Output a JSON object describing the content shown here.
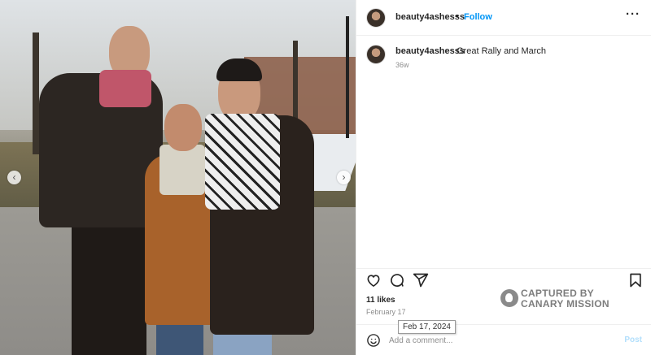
{
  "post": {
    "username": "beauty4ashesss",
    "follow_label": "Follow",
    "dot": "•",
    "more_label": "···",
    "caption_username": "beauty4ashesss",
    "caption_text": "Great Rally and March",
    "caption_time": "36w",
    "likes": "11 likes",
    "date": "February 17",
    "date_tooltip": "Feb 17, 2024",
    "comment_placeholder": "Add a comment...",
    "post_label": "Post"
  },
  "photo": {
    "prev_arrow": "‹",
    "next_arrow": "›"
  },
  "watermark": {
    "line1": "CAPTURED BY",
    "line2": "CANARY MISSION"
  },
  "icons": {
    "like": "heart-icon",
    "comment": "comment-icon",
    "share": "share-icon",
    "save": "bookmark-icon",
    "emoji": "emoji-icon"
  },
  "colors": {
    "accent": "#0095f6",
    "post_disabled": "#b2dffc",
    "muted": "#8e8e8e"
  }
}
